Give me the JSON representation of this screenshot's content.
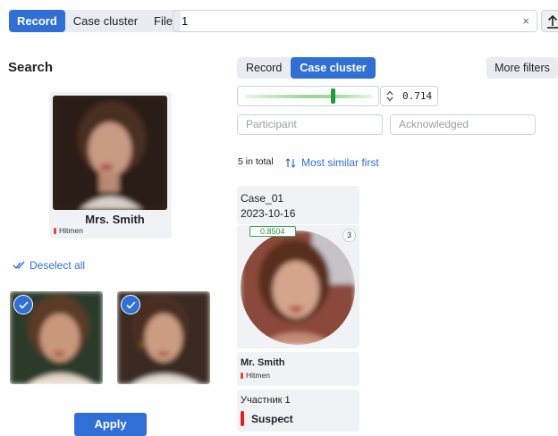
{
  "top_tabs": [
    {
      "label": "Record",
      "active": true
    },
    {
      "label": "Case cluster",
      "active": false
    },
    {
      "label": "File",
      "active": false
    }
  ],
  "search": {
    "value": "1",
    "clear_icon": "×"
  },
  "left": {
    "title": "Search",
    "main_card": {
      "name": "Mrs. Smith",
      "tag": "Hitmen"
    },
    "deselect_label": "Deselect all",
    "apply_label": "Apply"
  },
  "right": {
    "tabs": [
      {
        "label": "Record",
        "active": false
      },
      {
        "label": "Case cluster",
        "active": true
      }
    ],
    "more_filters_label": "More filters",
    "threshold": {
      "value": "0.714",
      "fraction": 0.714
    },
    "participant_placeholder": "Participant",
    "acknowledged_placeholder": "Acknowledged",
    "total_label": "5 in total",
    "sort_label": "Most similar first",
    "case": {
      "name": "Case_01",
      "date": "2023-10-16",
      "score": "0.8504",
      "count": "3",
      "person_name": "Mr. Smith",
      "person_tag": "Hitmen",
      "participant_label": "Участник 1",
      "status": "Suspect"
    }
  },
  "colors": {
    "accent": "#2f6fd6",
    "tag": "#e24b3b",
    "score": "#3aa55a",
    "suspect": "#e02020"
  }
}
